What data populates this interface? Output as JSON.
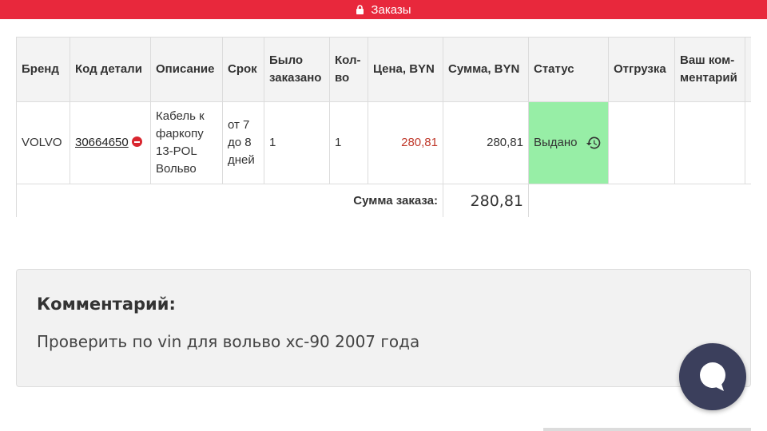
{
  "header": {
    "title": "Заказы"
  },
  "table": {
    "columns": {
      "brand": "Бренд",
      "code": "Код детали",
      "description": "Описание",
      "term": "Срок",
      "ordered": "Было заказано",
      "qty": "Кол-во",
      "price": "Цена, BYN",
      "sum": "Сумма, BYN",
      "status": "Статус",
      "shipment": "Отгрузка",
      "comment": "Ваш ком-ментарий"
    },
    "row": {
      "brand": "VOLVO",
      "code": "30664650",
      "description": "Кабель к фаркопу 13-POL Вольво",
      "term": "от 7 до 8 дней",
      "ordered": "1",
      "qty": "1",
      "price": "280,81",
      "sum": "280,81",
      "status": "Выдано",
      "shipment": "",
      "comment": ""
    },
    "total_label": "Сумма заказа:",
    "total_value": "280,81"
  },
  "comment": {
    "title": "Комментарий:",
    "text": "Проверить по vin для вольво xc-90 2007 года"
  },
  "colors": {
    "topbar": "#e8283c",
    "status_bg": "#97eea6",
    "price": "#c0392b",
    "chat": "#3b3f5c"
  },
  "icons": {
    "lock": "lock-icon",
    "remove": "minus-circle-icon",
    "history": "history-icon",
    "chat": "chat-bubble-icon"
  }
}
